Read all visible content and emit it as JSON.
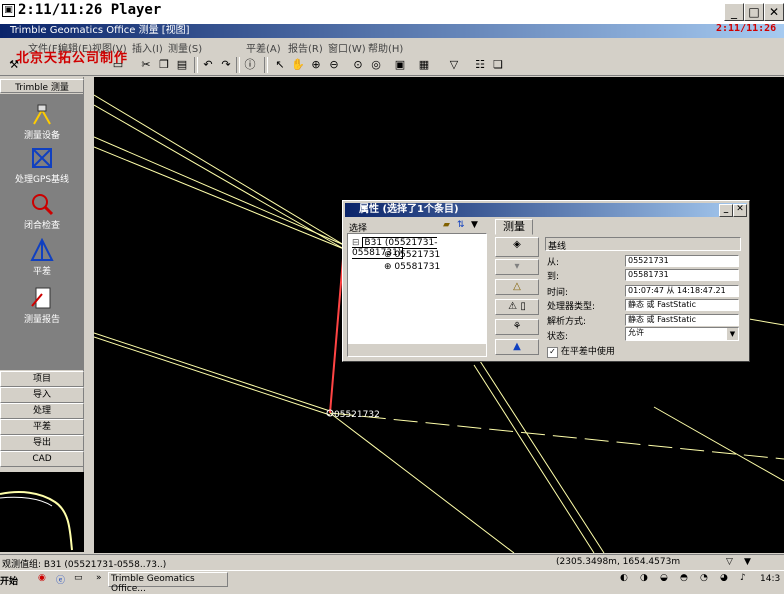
{
  "player": {
    "title": "2:11/11:26 Player",
    "icon": "player-icon",
    "minimize": "_",
    "maximize": "□",
    "close": "✕"
  },
  "app": {
    "title": "Trimble Geomatics Office  测量  [视图]",
    "clock": "2:11/11:26",
    "watermark": "北京天拓公司制作"
  },
  "menu": [
    "文件(F)",
    "编辑(E)",
    "视图(V)",
    "插入(I)",
    "测量(S)",
    "平差(A)",
    "报告(R)",
    "窗口(W)",
    "帮助(H)"
  ],
  "left_panel": {
    "header": "Trimble 测量",
    "tools": [
      {
        "label": "测量设备",
        "icon": "survey-device-icon"
      },
      {
        "label": "处理GPS基线",
        "icon": "gps-baseline-icon"
      },
      {
        "label": "闭合检查",
        "icon": "loop-closure-icon"
      },
      {
        "label": "平差",
        "icon": "adjustment-icon"
      },
      {
        "label": "测量报告",
        "icon": "survey-report-icon"
      }
    ],
    "buttons": [
      "项目",
      "导入",
      "处理",
      "平差",
      "导出",
      "CAD"
    ]
  },
  "map": {
    "point_label": "05521732",
    "colors": {
      "line": "#ffffaa",
      "baseline": "#ff4444",
      "bg": "#000000"
    }
  },
  "dialog": {
    "title": "属性 (选择了1个条目)",
    "select_label": "选择",
    "tree_root": "B31 (05521731-05581731)",
    "tree_children": [
      "05521731",
      "05581731"
    ],
    "tab": "测量",
    "section": "基线",
    "fields": [
      {
        "label": "从:",
        "value": "05521731"
      },
      {
        "label": "到:",
        "value": "05581731"
      },
      {
        "label": "时间:",
        "value": "01:07:47 从 14:18:47.21"
      },
      {
        "label": "处理器类型:",
        "value": "静态 或 FastStatic"
      },
      {
        "label": "解析方式:",
        "value": "静态 或 FastStatic"
      },
      {
        "label": "状态:",
        "value": "允许"
      }
    ],
    "checkbox_label": "在平差中使用",
    "checkbox_checked": true
  },
  "status": {
    "left": "观测值组: B31 (05521731-0558..73..)",
    "coords": "(2305.3498m, 1654.4573m"
  },
  "taskbar": {
    "start": "开始",
    "task": "Trimble Geomatics Office...",
    "time": "14:3"
  }
}
